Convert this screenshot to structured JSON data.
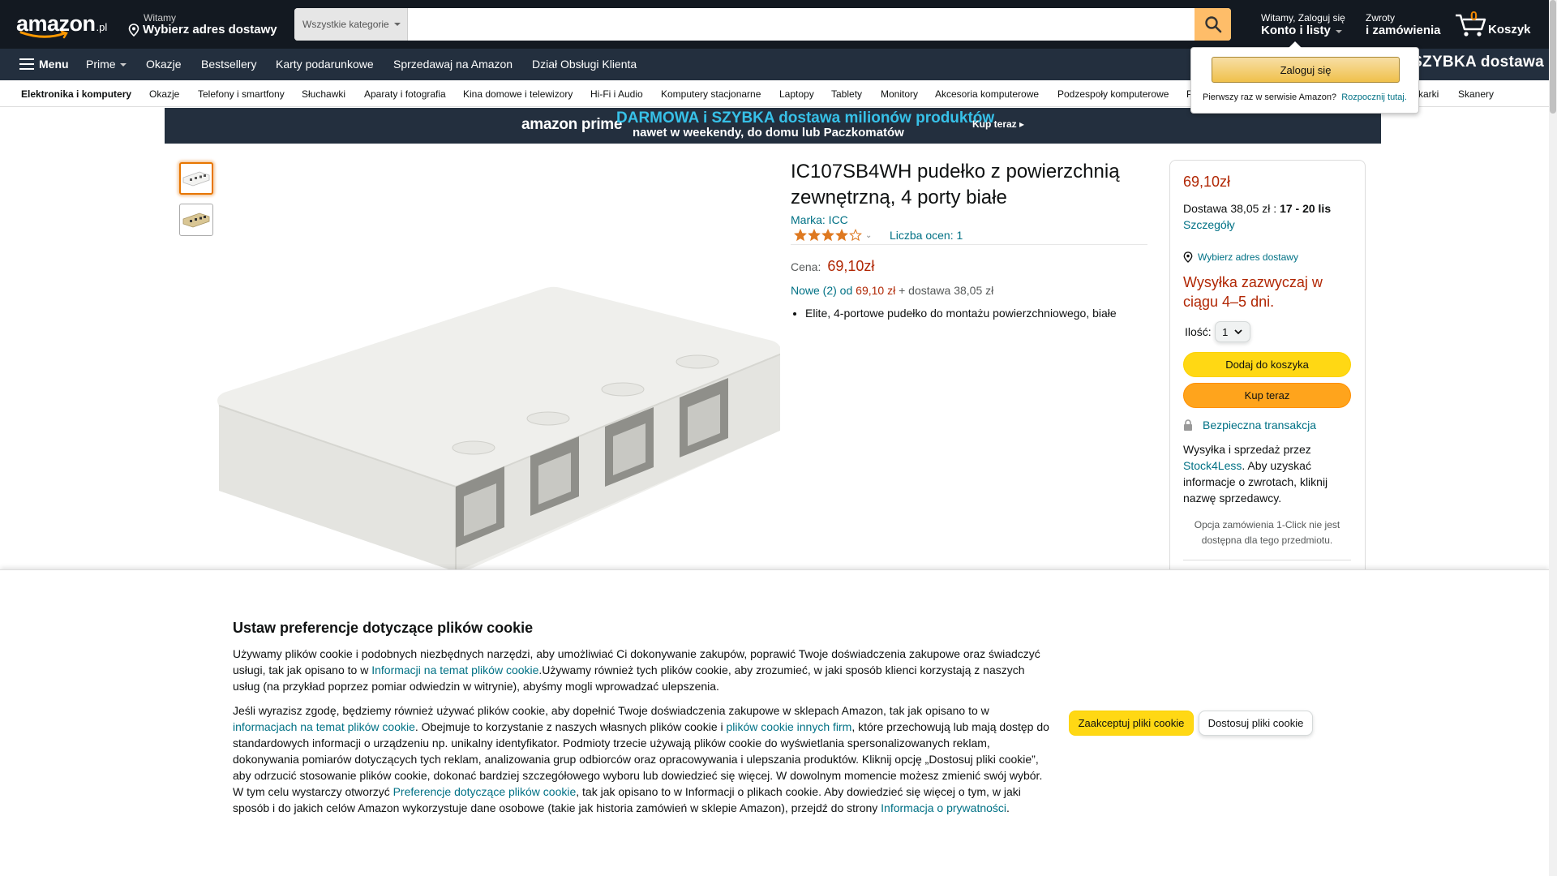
{
  "header": {
    "logo_text": "amazon",
    "logo_tld": ".pl",
    "deliver_line1": "Witamy",
    "deliver_line2": "Wybierz adres dostawy",
    "search_category": "Wszystkie kategorie",
    "search_placeholder": "",
    "account_line1": "Witamy, Zaloguj się",
    "account_line2": "Konto i listy",
    "returns_line1": "Zwroty",
    "returns_line2": "i zamówienia",
    "cart_count": "0",
    "cart_label": "Koszyk"
  },
  "main_nav": {
    "menu": "Menu",
    "items": [
      "Prime",
      "Okazje",
      "Bestsellery",
      "Karty podarunkowe",
      "Sprzedawaj na Amazon",
      "Dział Obsługi Klienta"
    ],
    "promo": "SZYBKA dostawa"
  },
  "sub_nav": {
    "items": [
      "Elektronika i komputery",
      "Okazje",
      "Telefony i smartfony",
      "Słuchawki",
      "Aparaty i fotografia",
      "Kina domowe i telewizory",
      "Hi-Fi i Audio",
      "Komputery stacjonarne",
      "Laptopy",
      "Tablety",
      "Monitory",
      "Akcesoria komputerowe",
      "Podzespoły komputerowe",
      "P",
      "karki",
      "Skanery"
    ]
  },
  "banner": {
    "brand": "amazon prime",
    "line1": "DARMOWA i SZYBKA dostawa milionów produktów",
    "line2": "nawet w weekendy, do domu lub Paczkomatów",
    "cta": "Kup teraz ▸"
  },
  "flyout": {
    "signin": "Zaloguj się",
    "new_customer": "Pierwszy raz w serwisie Amazon?",
    "start_link": "Rozpocznij tutaj."
  },
  "product": {
    "title": "IC107SB4WH pudełko z powierzchnią zewnętrzną, 4 porty białe",
    "brand": "Marka: ICC",
    "rating": 4,
    "rating_max": 5,
    "ratings_count": "Liczba ocen: 1",
    "price_label": "Cena:",
    "price": "69,10zł",
    "offers_link": "Nowe (2) od",
    "offers_price": "69,10 zł",
    "offers_delivery": "+ dostawa 38,05 zł",
    "bullets": [
      "Elite, 4-portowe pudełko do montażu powierzchniowego, białe"
    ]
  },
  "buybox": {
    "price": "69,10zł",
    "delivery_prefix": "Dostawa 38,05 zł :",
    "delivery_dates": "17 - 20 lis",
    "details": "Szczegóły",
    "address": "Wybierz adres dostawy",
    "shipping": "Wysyłka zazwyczaj w ciągu 4–5 dni.",
    "qty_label": "Ilość:",
    "qty_value": "1",
    "add_to_cart": "Dodaj do koszyka",
    "buy_now": "Kup teraz",
    "secure": "Bezpieczna transakcja",
    "seller_prefix": "Wysyłka i sprzedaż przez",
    "seller_name": "Stock4Less",
    "seller_suffix": ". Aby uzyskać informacje o zwrotach, kliknij nazwę sprzedawcy.",
    "one_click": "Opcja zamówienia 1-Click nie jest dostępna dla tego przedmiotu."
  },
  "cookie": {
    "title": "Ustaw preferencje dotyczące plików cookie",
    "p1_a": "Używamy plików cookie i podobnych niezbędnych narzędzi, aby umożliwiać Ci dokonywanie zakupów, poprawić Twoje doświadczenia zakupowe oraz świadczyć usługi, tak jak opisano to w ",
    "p1_link": "Informacji na temat plików cookie",
    "p1_b": ".Używamy również tych plików cookie, aby zrozumieć, w jaki sposób klienci korzystają z naszych usług (na przykład poprzez pomiar odwiedzin w witrynie), abyśmy mogli wprowadzać ulepszenia.",
    "p2_a": "Jeśli wyrazisz zgodę, będziemy również używać plików cookie, aby dopełnić Twoje doświadczenia zakupowe w sklepach Amazon, tak jak opisano to w ",
    "p2_link1": "informacjach na temat plików cookie",
    "p2_b": ". Obejmuje to korzystanie z naszych własnych plików cookie i ",
    "p2_link2": "plików cookie innych firm",
    "p2_c": ", które przechowują lub mają dostęp do standardowych informacji o urządzeniu np. unikalny identyfikator. Podmioty trzecie używają plików cookie do wyświetlania spersonalizowanych reklam, dokonywania pomiarów dotyczących tych reklam, analizowania grup odbiorców oraz opracowywania i ulepszania produktów. Kliknij opcję „Dostosuj pliki cookie”, aby odrzucić stosowanie plików cookie, dokonać bardziej szczegółowego wyboru lub dowiedzieć się więcej. W dowolnym momencie możesz zmienić swój wybór. W tym celu wystarczy otworzyć ",
    "p2_link3": "Preferencje dotyczące plików cookie",
    "p2_d": ", tak jak opisano to w Informacji o plikach cookie. Aby dowiedzieć się więcej o tym, w jaki sposób i do jakich celów Amazon wykorzystuje dane osobowe (takie jak historia zamówień w sklepie Amazon), przejdź do strony ",
    "p2_link4": "Informacja o prywatności",
    "p2_e": ".",
    "accept": "Zaakceptuj pliki cookie",
    "customize": "Dostosuj pliki cookie"
  },
  "colors": {
    "nav_dark": "#131921",
    "nav_main": "#232f3e",
    "price_red": "#b12704",
    "link": "#007185",
    "button_yellow": "#ffd814",
    "button_orange": "#ffa41c"
  }
}
